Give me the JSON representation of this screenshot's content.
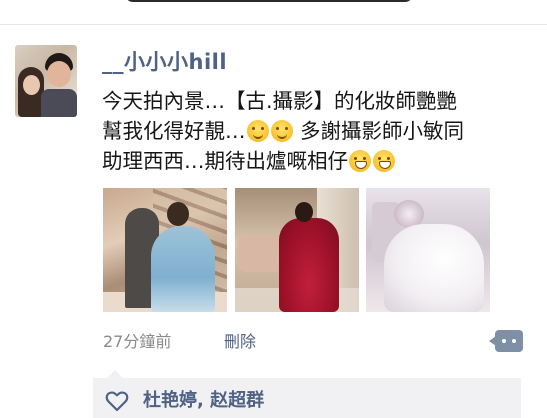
{
  "post": {
    "username": "__小小小hill",
    "text_line1": "今天拍內景…【古.攝影】的化妝師艷艷",
    "text_line2_a": "幫我化得好靚…",
    "text_line2_b": "多謝攝影師小敏同",
    "text_line3": "助理西西…期待出爐嘅相仔",
    "emoji_names": [
      "smiling-face-icon",
      "smiling-face-icon",
      "grinning-face-icon",
      "grinning-face-icon"
    ],
    "photo_count": 3
  },
  "meta": {
    "time": "27分鐘前",
    "delete_label": "刪除"
  },
  "likes": {
    "names": "杜艳婷, 赵超群"
  },
  "colors": {
    "link": "#4f6185",
    "meta_gray": "#8a8a8a",
    "likes_bg": "#f1f1f3",
    "comment_button": "#7f8fa6"
  }
}
